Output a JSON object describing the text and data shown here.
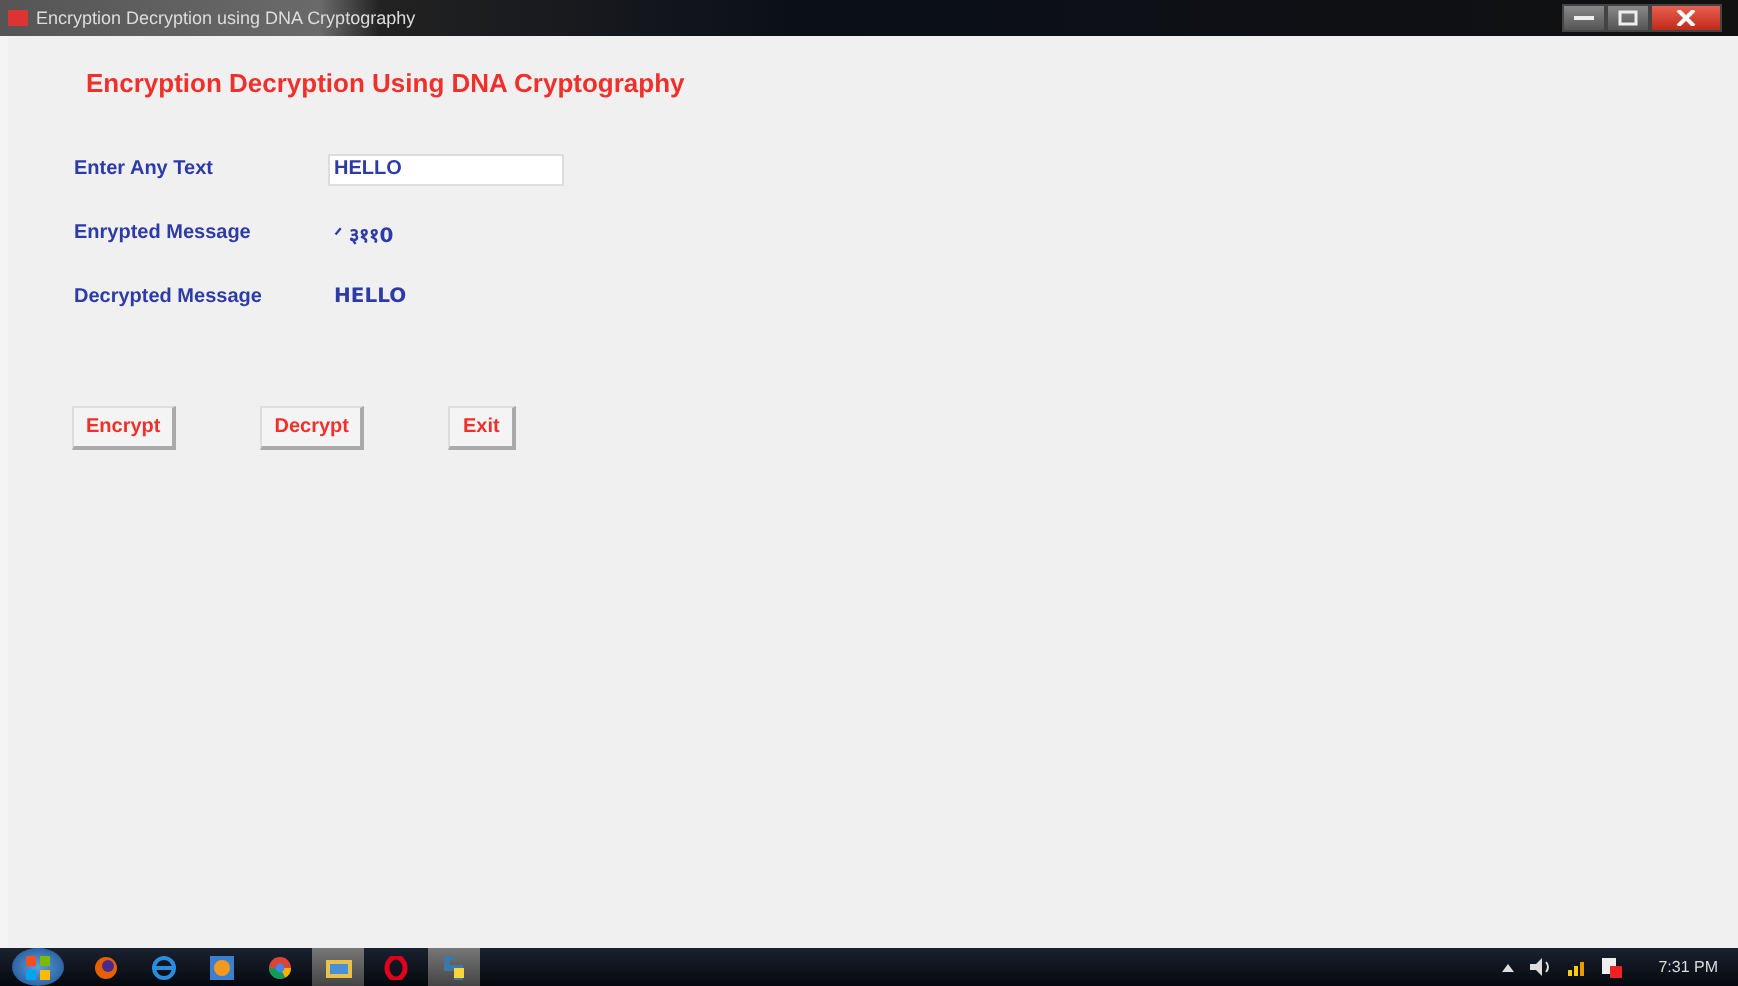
{
  "window": {
    "title": "Encryption Decryption using DNA Cryptography"
  },
  "heading": "Encryption Decryption Using DNA Cryptography",
  "fields": [
    {
      "kind": "input",
      "label": "Enter Any Text",
      "value": "HELLO"
    },
    {
      "kind": "output",
      "label": "Enrypted Message",
      "value": "ᐟ ३११0"
    },
    {
      "kind": "output",
      "label": "Decrypted Message",
      "value": "HELLO"
    }
  ],
  "buttons": [
    "Encrypt",
    "Decrypt",
    "Exit"
  ],
  "taskbar": {
    "clock": "7:31 PM"
  }
}
